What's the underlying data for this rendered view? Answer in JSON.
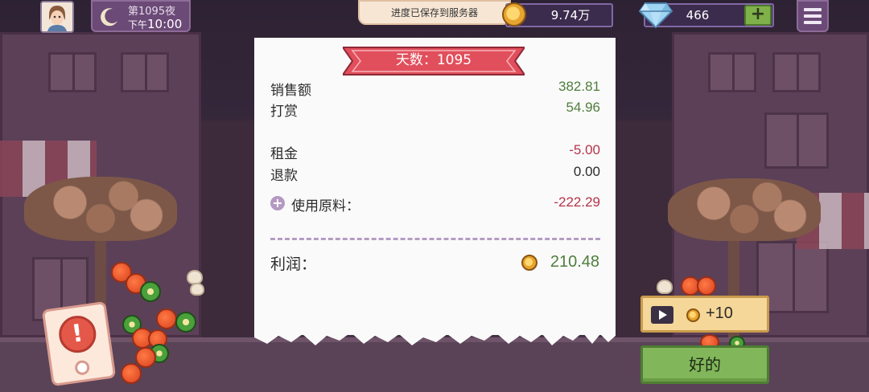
{
  "hud": {
    "night_label": "第1095夜",
    "ampm": "下午",
    "clock": "10:00",
    "toast": "进度已保存到服务器",
    "coins": "9.74万",
    "gems": "466",
    "gem_plus": "+"
  },
  "receipt": {
    "banner": "天数：1095",
    "rows": [
      {
        "label": "销售额",
        "value": "382.81"
      },
      {
        "label": "打赏",
        "value": "54.96"
      },
      {
        "label": "租金",
        "value": "-5.00"
      },
      {
        "label": "退款",
        "value": "0.00"
      },
      {
        "label": "使用原料：",
        "value": "-222.29"
      }
    ],
    "profit_label": "利润：",
    "profit_value": "210.48"
  },
  "buttons": {
    "ad_reward": "+10",
    "ok": "好的"
  },
  "colors": {
    "positive": "#4f7d3c",
    "negative": "#b4334a",
    "neutral": "#2b2b2b",
    "ok_button": "#82b65a",
    "hud_purple": "#6c4a78"
  },
  "icons": [
    "avatar",
    "moon-icon",
    "coin-icon",
    "gem-icon",
    "plus-icon",
    "menu-icon",
    "play-icon",
    "alert-icon"
  ]
}
